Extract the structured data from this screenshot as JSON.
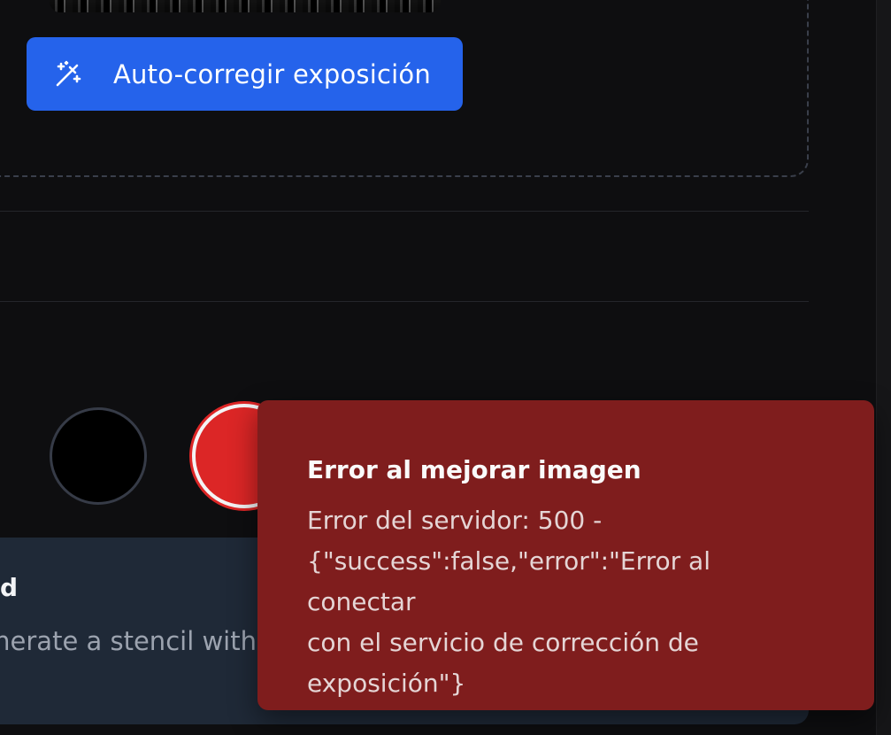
{
  "toolbar": {
    "auto_correct_label": "Auto-corregir exposición",
    "auto_correct_icon": "magic-wand-sparkles-icon"
  },
  "swatches": [
    {
      "name": "black",
      "color": "#000000",
      "selected": false
    },
    {
      "name": "red",
      "color": "#dc2626",
      "selected": true
    }
  ],
  "info_card": {
    "title_fragment": "d",
    "text_fragment": "enerate a stencil with"
  },
  "toast": {
    "title": "Error al mejorar imagen",
    "message": "Error del servidor: 500 -\n{\"success\":false,\"error\":\"Error al conectar\ncon el servicio de corrección de\nexposición\"}"
  },
  "colors": {
    "accent": "#2563eb",
    "toast_bg": "#7f1d1d",
    "card_bg": "#1f2937",
    "page_bg": "#0e0e10"
  }
}
